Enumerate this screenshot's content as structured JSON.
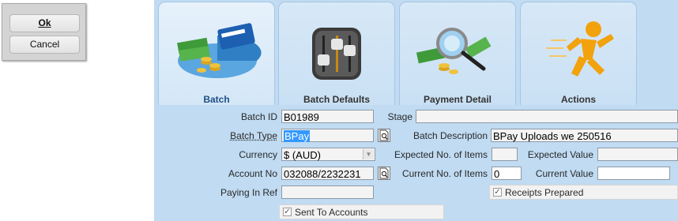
{
  "buttons": {
    "ok_label": "Ok",
    "cancel_label": "Cancel"
  },
  "tabs": [
    {
      "label": "Batch",
      "icon": "batch-money-card-icon",
      "active": true
    },
    {
      "label": "Batch Defaults",
      "icon": "sliders-icon",
      "active": false
    },
    {
      "label": "Payment Detail",
      "icon": "magnifier-money-icon",
      "active": false
    },
    {
      "label": "Actions",
      "icon": "running-man-icon",
      "active": false
    }
  ],
  "form": {
    "batch_id": {
      "label": "Batch ID",
      "value": "B01989"
    },
    "stage": {
      "label": "Stage",
      "value": ""
    },
    "batch_type": {
      "label": "Batch Type",
      "value": "BPay"
    },
    "batch_description": {
      "label": "Batch Description",
      "value": "BPay Uploads we 250516"
    },
    "currency": {
      "label": "Currency",
      "value": "$ (AUD)"
    },
    "expected_items": {
      "label": "Expected No. of Items",
      "value": ""
    },
    "expected_value": {
      "label": "Expected Value",
      "value": ""
    },
    "account_no": {
      "label": "Account No",
      "value": "032088/2232231"
    },
    "current_items": {
      "label": "Current No. of Items",
      "value": "0"
    },
    "current_value": {
      "label": "Current Value",
      "value": ""
    },
    "paying_in_ref": {
      "label": "Paying In Ref",
      "value": ""
    },
    "receipts_prepared": {
      "label": "Receipts Prepared",
      "checked": true
    },
    "sent_to_accounts": {
      "label": "Sent To Accounts",
      "checked": true
    }
  },
  "colors": {
    "panel": "#c0dbf2",
    "tab": "#d7e8f7",
    "active_label": "#1f4f86",
    "selection": "#3399ff"
  }
}
